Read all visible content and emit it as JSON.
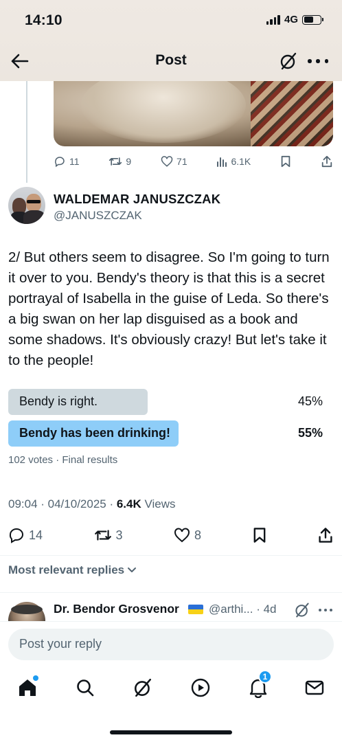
{
  "status_bar": {
    "time": "14:10",
    "network": "4G"
  },
  "header": {
    "title": "Post"
  },
  "previous_tweet": {
    "actions": {
      "replies": "11",
      "reposts": "9",
      "likes": "71",
      "views": "6.1K"
    }
  },
  "author": {
    "name": "WALDEMAR JANUSZCZAK",
    "handle": "@JANUSZCZAK"
  },
  "tweet": {
    "text": "2/ But others seem to disagree. So I'm going to turn it over to you. Bendy's theory is that this is a secret portrayal of Isabella in the guise of Leda. So there's a big swan on her lap disguised as a book and some shadows. It's obviously crazy! But let's take it to the people!"
  },
  "poll": {
    "options": [
      {
        "label": "Bendy is right.",
        "percent_text": "45%",
        "percent": 45,
        "winner": false
      },
      {
        "label": "Bendy has been drinking!",
        "percent_text": "55%",
        "percent": 55,
        "winner": true
      }
    ],
    "meta": "102 votes · Final results"
  },
  "timestamp": {
    "datetime": "09:04 · 04/10/2025 · ",
    "views_count": "6.4K",
    "views_label": " Views"
  },
  "actions": {
    "replies": "14",
    "reposts": "3",
    "likes": "8"
  },
  "replies_sort": "Most relevant replies",
  "reply_preview": {
    "name": "Dr. Bendor Grosvenor",
    "handle": "@arthi... · 4d"
  },
  "reply_input": {
    "placeholder": "Post your reply"
  },
  "nav": {
    "notifications_badge": "1"
  },
  "colors": {
    "accent": "#1d9bf0",
    "poll_winner": "#8ecdf8",
    "poll_loser": "#cfd9de",
    "muted": "#536471"
  },
  "icons": [
    "back-arrow-icon",
    "grok-icon",
    "more-icon",
    "reply-icon",
    "repost-icon",
    "like-icon",
    "views-icon",
    "bookmark-icon",
    "share-icon",
    "chevron-down-icon",
    "home-icon",
    "search-icon",
    "play-icon",
    "bell-icon",
    "mail-icon"
  ]
}
